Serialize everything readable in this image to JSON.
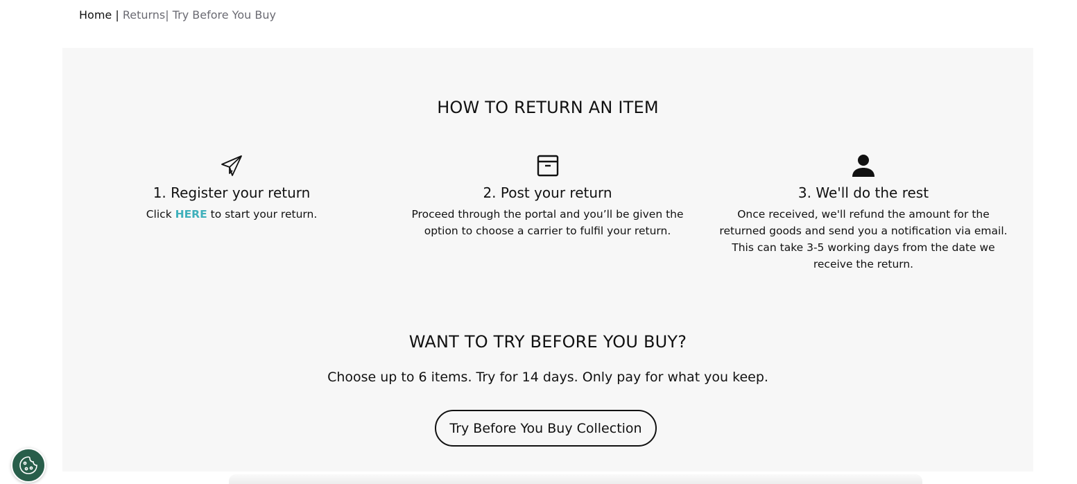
{
  "breadcrumb": {
    "home": "Home",
    "separator": " |",
    "returns": " Returns",
    "try_before": "| Try Before You Buy"
  },
  "returns_section": {
    "title": "HOW TO RETURN AN ITEM",
    "steps": [
      {
        "icon": "paper-plane-icon",
        "title": "1. Register your return",
        "text_before": "Click ",
        "link_text": "HERE",
        "text_after": " to start your return."
      },
      {
        "icon": "box-icon",
        "title": "2. Post your return",
        "text": "Proceed through the portal and you’ll be given the option to choose a carrier to fulfil your return."
      },
      {
        "icon": "person-icon",
        "title": "3. We'll do the rest",
        "text": "Once received, we'll refund the amount for the returned goods and send you a notification via email. This can take 3-5 working days from the date we receive the return."
      }
    ]
  },
  "try_section": {
    "title": "WANT TO TRY BEFORE YOU BUY?",
    "tagline": "Choose up to 6 items. Try for 14 days. Only pay for what you keep.",
    "button_label": "Try Before You Buy Collection"
  },
  "colors": {
    "panel_bg": "#f7f7f7",
    "link_accent": "#3fb0bb",
    "cookie_button_bg": "#285e4a"
  },
  "cookie_button": {
    "icon": "cookie-icon"
  }
}
